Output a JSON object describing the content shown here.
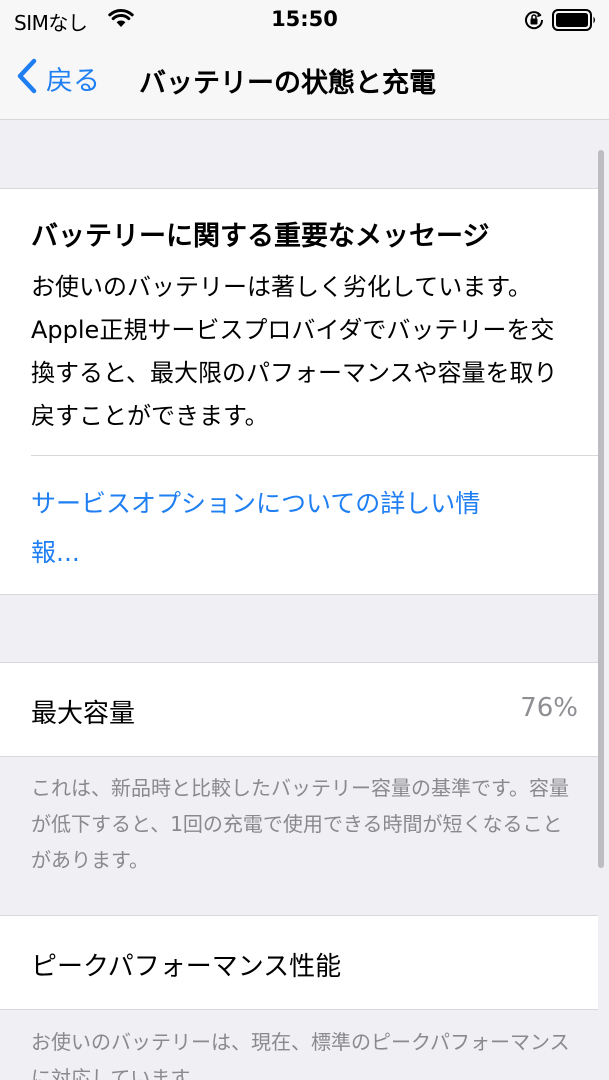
{
  "status_bar": {
    "carrier": "SIMなし",
    "time": "15:50",
    "icons": [
      "wifi-icon",
      "orientation-lock-icon",
      "battery-icon"
    ]
  },
  "nav": {
    "back_label": "戻る",
    "title": "バッテリーの状態と充電"
  },
  "message": {
    "heading": "バッテリーに関する重要なメッセージ",
    "body": "お使いのバッテリーは著しく劣化しています。Apple正規サービスプロバイダでバッテリーを交換すると、最大限のパフォーマンスや容量を取り戻すことができます。",
    "link": "サービスオプションについての詳しい情報..."
  },
  "capacity": {
    "label": "最大容量",
    "value": "76%",
    "note": "これは、新品時と比較したバッテリー容量の基準です。容量が低下すると、1回の充電で使用できる時間が短くなることがあります。"
  },
  "peak": {
    "label": "ピークパフォーマンス性能",
    "note": "お使いのバッテリーは、現在、標準のピークパフォーマンスに対応しています。"
  },
  "colors": {
    "accent": "#1f7ff2",
    "background": "#efeff4",
    "secondary_text": "#8e8e93"
  }
}
